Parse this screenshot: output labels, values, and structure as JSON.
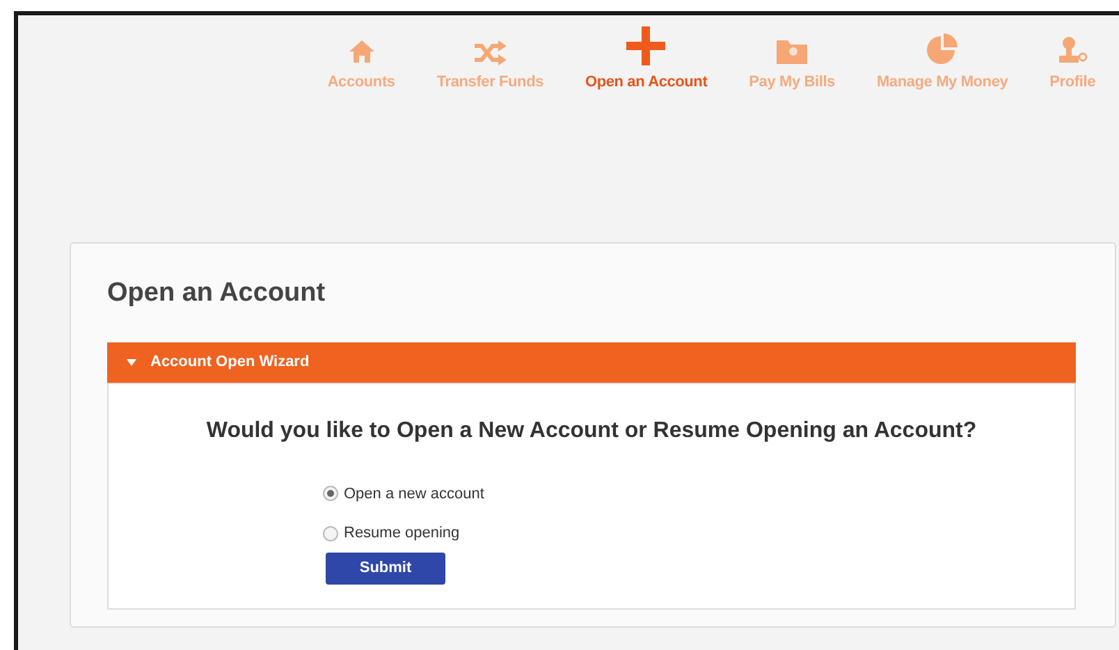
{
  "nav": [
    {
      "label": "Accounts",
      "selected": false
    },
    {
      "label": "Transfer Funds",
      "selected": false
    },
    {
      "label": "Open an Account",
      "selected": true
    },
    {
      "label": "Pay My Bills",
      "selected": false
    },
    {
      "label": "Manage My Money",
      "selected": false
    },
    {
      "label": "Profile",
      "selected": false
    }
  ],
  "panel": {
    "title": "Open an Account",
    "wizard": {
      "title": "Account Open Wizard",
      "expanded": true,
      "question": "Would you like to Open a New Account or Resume Opening an Account?",
      "options": [
        {
          "label": "Open a new account",
          "selected": true
        },
        {
          "label": "Resume opening",
          "selected": false
        }
      ],
      "button": "Submit"
    }
  }
}
